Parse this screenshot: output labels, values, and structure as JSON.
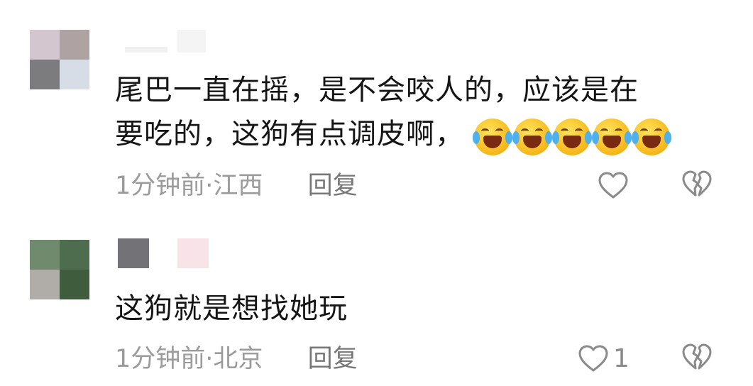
{
  "comments": [
    {
      "text_line1": "尾巴一直在摇，是不会咬人的，应该是在",
      "text_line2": "要吃的，这狗有点调皮啊，",
      "emoji_icons": [
        "rofl-icon",
        "rofl-icon",
        "rofl-icon",
        "rofl-icon",
        "rofl-icon"
      ],
      "time": "1分钟前",
      "separator": " · ",
      "location": "江西",
      "reply_label": "回复",
      "like_count": "",
      "avatar_colors": [
        "#d3c6cf",
        "#aea2a3",
        "#7c7c7e",
        "#d7dde6"
      ]
    },
    {
      "text_line1": "这狗就是想找她玩",
      "time": "1分钟前",
      "separator": " · ",
      "location": "北京",
      "reply_label": "回复",
      "like_count": "1",
      "avatar_colors": [
        "#6f8a6d",
        "#4d6d4e",
        "#b0aca7",
        "#3f5d3c"
      ]
    }
  ],
  "icons": {
    "like": "heart-outline-icon",
    "dislike": "broken-heart-icon"
  },
  "colors": {
    "text": "#151515",
    "meta": "#9b9b9b",
    "icon": "#8a8a8a"
  }
}
